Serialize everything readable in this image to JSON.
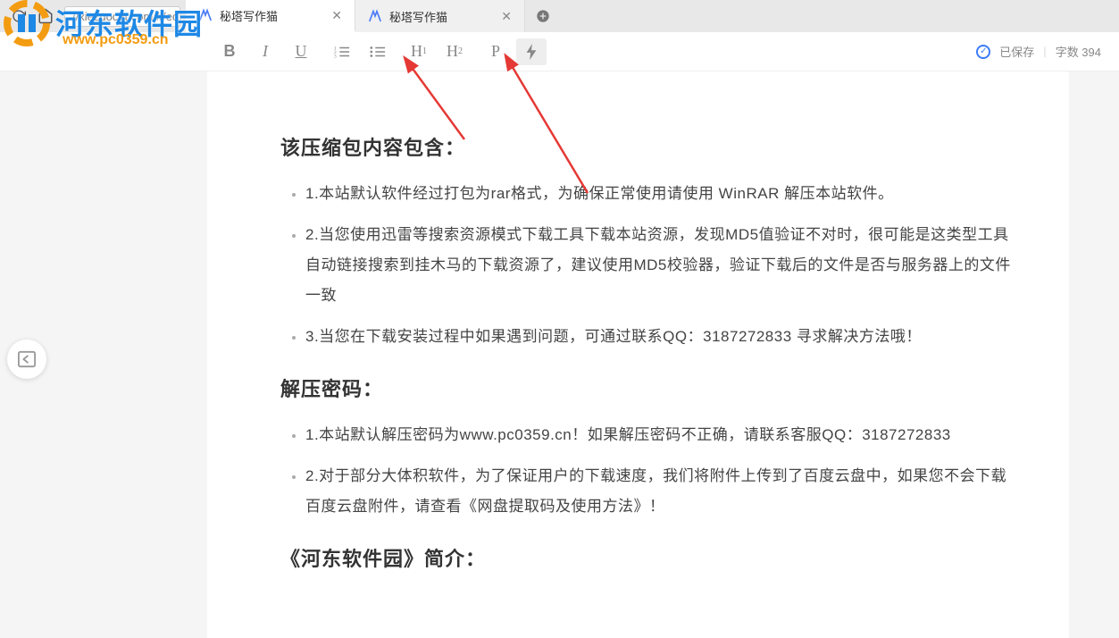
{
  "browser": {
    "url": "//xiezuocat.com/#/ed",
    "tabs": [
      {
        "title": "秘塔写作猫",
        "active": true
      },
      {
        "title": "秘塔写作猫",
        "active": false
      }
    ]
  },
  "watermark": {
    "cn": "河东软件园",
    "url": "www.pc0359.cn"
  },
  "toolbar": {
    "bold": "B",
    "italic": "I",
    "underline": "U",
    "ol_icon": "ol",
    "ul_icon": "ul",
    "h1": "H",
    "h2": "H",
    "p": "P",
    "bolt": "⚡"
  },
  "status": {
    "saved_label": "已保存",
    "wordcount_label": "字数 394"
  },
  "doc": {
    "h1": "该压缩包内容包含：",
    "s1": [
      "1.本站默认软件经过打包为rar格式，为确保正常使用请使用 WinRAR 解压本站软件。",
      "2.当您使用迅雷等搜索资源模式下载工具下载本站资源，发现MD5值验证不对时，很可能是这类型工具自动链接搜索到挂木马的下载资源了，建议使用MD5校验器，验证下载后的文件是否与服务器上的文件一致",
      "3.当您在下载安装过程中如果遇到问题，可通过联系QQ：3187272833 寻求解决方法哦！"
    ],
    "h2": "解压密码：",
    "s2": [
      "1.本站默认解压密码为www.pc0359.cn！如果解压密码不正确，请联系客服QQ：3187272833",
      "2.对于部分大体积软件，为了保证用户的下载速度，我们将附件上传到了百度云盘中，如果您不会下载百度云盘附件，请查看《网盘提取码及使用方法》！"
    ],
    "h3": "《河东软件园》简介："
  }
}
